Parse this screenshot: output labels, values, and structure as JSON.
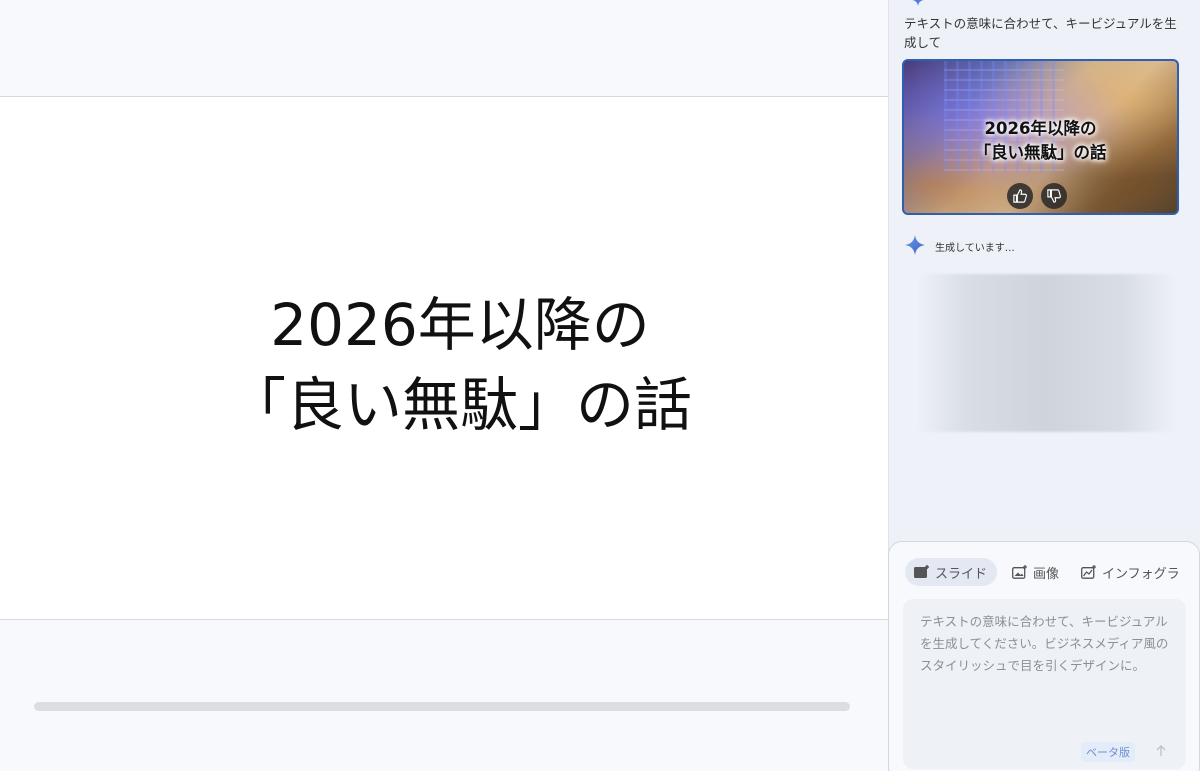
{
  "slide": {
    "title_line1": "2026年以降の",
    "title_line2": "「良い無駄」の話"
  },
  "chat": {
    "user_message": "テキストの意味に合わせて、キービジュアルを生成して",
    "thumbnail": {
      "text_line1": "2026年以降の",
      "text_line2": "「良い無駄」の話",
      "like_icon": "thumbs-up-icon",
      "dislike_icon": "thumbs-down-icon"
    },
    "status": "生成しています…"
  },
  "composer": {
    "tabs": [
      {
        "label": "スライド",
        "icon": "slide-icon",
        "selected": true
      },
      {
        "label": "画像",
        "icon": "image-icon",
        "selected": false
      },
      {
        "label": "インフォグラ",
        "icon": "infographic-icon",
        "selected": false
      }
    ],
    "prompt": "テキストの意味に合わせて、キービジュアルを生成してください。ビジネスメディア風のスタイリッシュで目を引くデザインに。",
    "beta_label": "ベータ版",
    "send_icon": "arrow-up-icon"
  },
  "colors": {
    "accent": "#2f5fae",
    "spark": "#4f7fd9"
  }
}
